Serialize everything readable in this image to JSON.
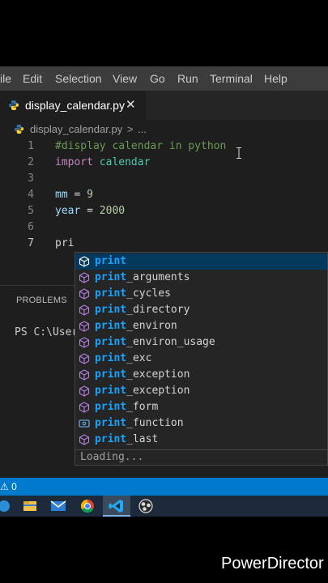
{
  "menu": [
    "ile",
    "Edit",
    "Selection",
    "View",
    "Go",
    "Run",
    "Terminal",
    "Help"
  ],
  "tab": {
    "label": "display_calendar.py",
    "close": "✕"
  },
  "breadcrumb": {
    "file": "display_calendar.py",
    "separator": ">",
    "more": "..."
  },
  "code": {
    "line_numbers": [
      "1",
      "2",
      "3",
      "4",
      "5",
      "6",
      "7"
    ],
    "line1_comment": "#display calendar in python",
    "line2_keyword": "import",
    "line2_module": "calendar",
    "line4_var": "mm",
    "line4_op": " = ",
    "line4_num": "9",
    "line5_var": "year",
    "line5_op": " = ",
    "line5_num": "2000",
    "line7_text": "pri"
  },
  "suggestions": {
    "items": [
      {
        "match": "print",
        "rest": ""
      },
      {
        "match": "print",
        "rest": "_arguments"
      },
      {
        "match": "print",
        "rest": "_cycles"
      },
      {
        "match": "print",
        "rest": "_directory"
      },
      {
        "match": "print",
        "rest": "_environ"
      },
      {
        "match": "print",
        "rest": "_environ_usage"
      },
      {
        "match": "print",
        "rest": "_exc"
      },
      {
        "match": "print",
        "rest": "_exception"
      },
      {
        "match": "print",
        "rest": "_exception"
      },
      {
        "match": "print",
        "rest": "_form"
      },
      {
        "match": "print",
        "rest": "_function"
      },
      {
        "match": "print",
        "rest": "_last"
      }
    ],
    "loading": "Loading..."
  },
  "panel": {
    "tab": "PROBLEMS",
    "terminal": "PS C:\\User"
  },
  "status": {
    "text": "⚠ 0"
  },
  "taskbar": {
    "icons": [
      "windows-icon",
      "file-explorer-icon",
      "mail-icon",
      "chrome-icon",
      "vscode-icon",
      "obs-icon"
    ]
  },
  "watermark": "PowerDirector",
  "colors": {
    "accent": "#007acc",
    "selection": "#04395e",
    "highlight": "#18a3ff"
  }
}
